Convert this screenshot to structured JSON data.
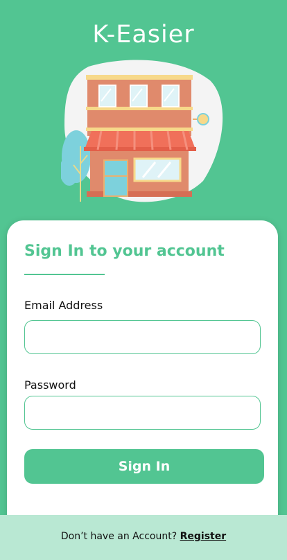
{
  "app": {
    "title": "K-Easier"
  },
  "illustration": {
    "icon": "storefront-icon"
  },
  "card": {
    "title": "Sign In to your account",
    "email": {
      "label": "Email Address",
      "value": "",
      "placeholder": ""
    },
    "password": {
      "label": "Password",
      "value": "",
      "placeholder": ""
    },
    "signin_label": "Sign In"
  },
  "footer": {
    "prompt": "Don’t have an Account?",
    "register_label": "Register"
  },
  "colors": {
    "brand": "#52c592",
    "footer_bg": "#b9e8d3",
    "card_bg": "#ffffff"
  }
}
